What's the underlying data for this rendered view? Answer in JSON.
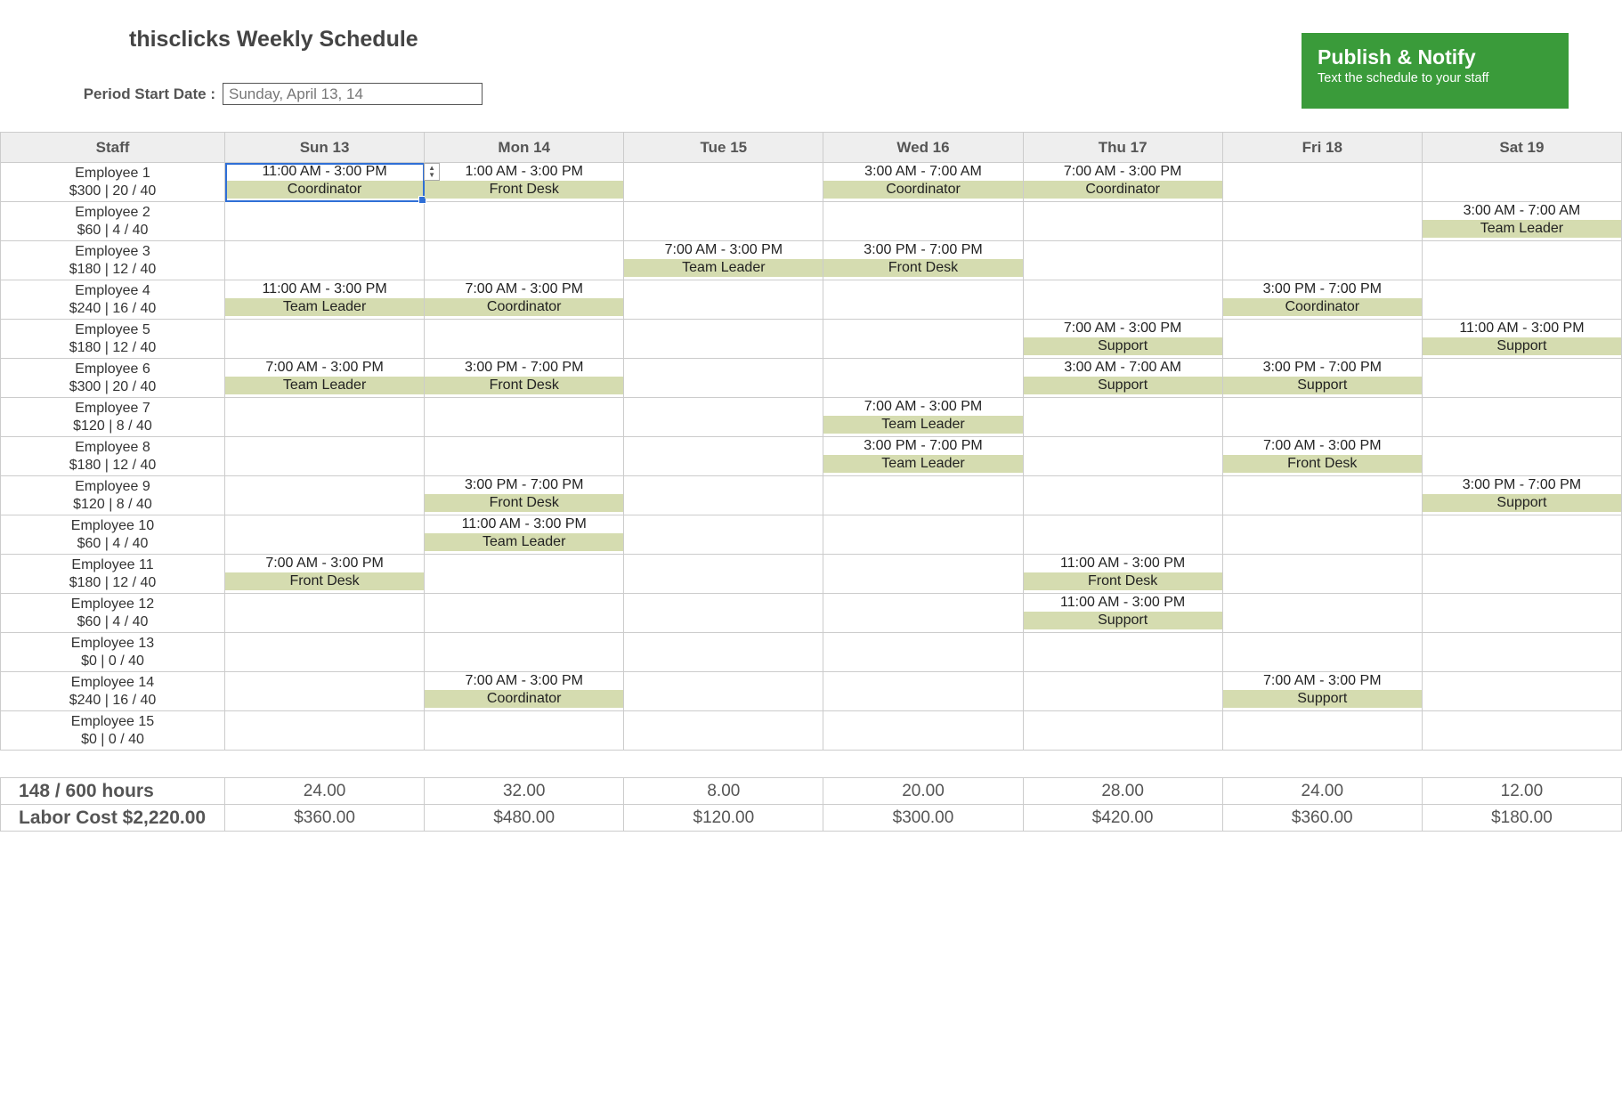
{
  "header": {
    "title": "thisclicks Weekly Schedule",
    "period_label": "Period Start Date :",
    "period_value": "Sunday, April 13, 14",
    "publish_title": "Publish & Notify",
    "publish_sub": "Text the schedule to your staff"
  },
  "columns": {
    "staff": "Staff",
    "days": [
      "Sun 13",
      "Mon 14",
      "Tue 15",
      "Wed 16",
      "Thu 17",
      "Fri 18",
      "Sat 19"
    ]
  },
  "employees": [
    {
      "name": "Employee 1",
      "stats": "$300 | 20 / 40",
      "shifts": [
        {
          "time": "11:00 AM - 3:00 PM",
          "role": "Coordinator",
          "selected": true
        },
        {
          "time": "1:00 AM - 3:00 PM",
          "role": "Front Desk",
          "stepper": true
        },
        null,
        {
          "time": "3:00 AM - 7:00 AM",
          "role": "Coordinator"
        },
        {
          "time": "7:00 AM - 3:00 PM",
          "role": "Coordinator"
        },
        null,
        null
      ]
    },
    {
      "name": "Employee 2",
      "stats": "$60 | 4 / 40",
      "shifts": [
        null,
        null,
        null,
        null,
        null,
        null,
        {
          "time": "3:00 AM - 7:00 AM",
          "role": "Team Leader"
        }
      ]
    },
    {
      "name": "Employee 3",
      "stats": "$180 | 12 / 40",
      "shifts": [
        null,
        null,
        {
          "time": "7:00 AM - 3:00 PM",
          "role": "Team Leader"
        },
        {
          "time": "3:00 PM - 7:00 PM",
          "role": "Front Desk"
        },
        null,
        null,
        null
      ]
    },
    {
      "name": "Employee 4",
      "stats": "$240 | 16 / 40",
      "shifts": [
        {
          "time": "11:00 AM - 3:00 PM",
          "role": "Team Leader"
        },
        {
          "time": "7:00 AM - 3:00 PM",
          "role": "Coordinator"
        },
        null,
        null,
        null,
        {
          "time": "3:00 PM - 7:00 PM",
          "role": "Coordinator"
        },
        null
      ]
    },
    {
      "name": "Employee 5",
      "stats": "$180 | 12 / 40",
      "shifts": [
        null,
        null,
        null,
        null,
        {
          "time": "7:00 AM - 3:00 PM",
          "role": "Support"
        },
        null,
        {
          "time": "11:00 AM - 3:00 PM",
          "role": "Support"
        }
      ]
    },
    {
      "name": "Employee 6",
      "stats": "$300 | 20 / 40",
      "shifts": [
        {
          "time": "7:00 AM - 3:00 PM",
          "role": "Team Leader"
        },
        {
          "time": "3:00 PM - 7:00 PM",
          "role": "Front Desk"
        },
        null,
        null,
        {
          "time": "3:00 AM - 7:00 AM",
          "role": "Support"
        },
        {
          "time": "3:00 PM - 7:00 PM",
          "role": "Support"
        },
        null
      ]
    },
    {
      "name": "Employee 7",
      "stats": "$120 | 8 / 40",
      "shifts": [
        null,
        null,
        null,
        {
          "time": "7:00 AM - 3:00 PM",
          "role": "Team Leader"
        },
        null,
        null,
        null
      ]
    },
    {
      "name": "Employee 8",
      "stats": "$180 | 12 / 40",
      "shifts": [
        null,
        null,
        null,
        {
          "time": "3:00 PM - 7:00 PM",
          "role": "Team Leader"
        },
        null,
        {
          "time": "7:00 AM - 3:00 PM",
          "role": "Front Desk"
        },
        null
      ]
    },
    {
      "name": "Employee 9",
      "stats": "$120 | 8 / 40",
      "shifts": [
        null,
        {
          "time": "3:00 PM - 7:00 PM",
          "role": "Front Desk"
        },
        null,
        null,
        null,
        null,
        {
          "time": "3:00 PM - 7:00 PM",
          "role": "Support"
        }
      ]
    },
    {
      "name": "Employee 10",
      "stats": "$60 | 4 / 40",
      "shifts": [
        null,
        {
          "time": "11:00 AM - 3:00 PM",
          "role": "Team Leader"
        },
        null,
        null,
        null,
        null,
        null
      ]
    },
    {
      "name": "Employee 11",
      "stats": "$180 | 12 / 40",
      "shifts": [
        {
          "time": "7:00 AM - 3:00 PM",
          "role": "Front Desk"
        },
        null,
        null,
        null,
        {
          "time": "11:00 AM - 3:00 PM",
          "role": "Front Desk"
        },
        null,
        null
      ]
    },
    {
      "name": "Employee 12",
      "stats": "$60 | 4 / 40",
      "shifts": [
        null,
        null,
        null,
        null,
        {
          "time": "11:00 AM - 3:00 PM",
          "role": "Support"
        },
        null,
        null
      ]
    },
    {
      "name": "Employee 13",
      "stats": "$0 | 0 / 40",
      "shifts": [
        null,
        null,
        null,
        null,
        null,
        null,
        null
      ]
    },
    {
      "name": "Employee 14",
      "stats": "$240 | 16 / 40",
      "shifts": [
        null,
        {
          "time": "7:00 AM - 3:00 PM",
          "role": "Coordinator"
        },
        null,
        null,
        null,
        {
          "time": "7:00 AM - 3:00 PM",
          "role": "Support"
        },
        null
      ]
    },
    {
      "name": "Employee 15",
      "stats": "$0 | 0 / 40",
      "shifts": [
        null,
        null,
        null,
        null,
        null,
        null,
        null
      ]
    }
  ],
  "summary": {
    "hours_label": "148 / 600 hours",
    "hours_row": [
      "24.00",
      "32.00",
      "8.00",
      "20.00",
      "28.00",
      "24.00",
      "12.00"
    ],
    "cost_label": "Labor Cost $2,220.00",
    "cost_row": [
      "$360.00",
      "$480.00",
      "$120.00",
      "$300.00",
      "$420.00",
      "$360.00",
      "$180.00"
    ]
  }
}
